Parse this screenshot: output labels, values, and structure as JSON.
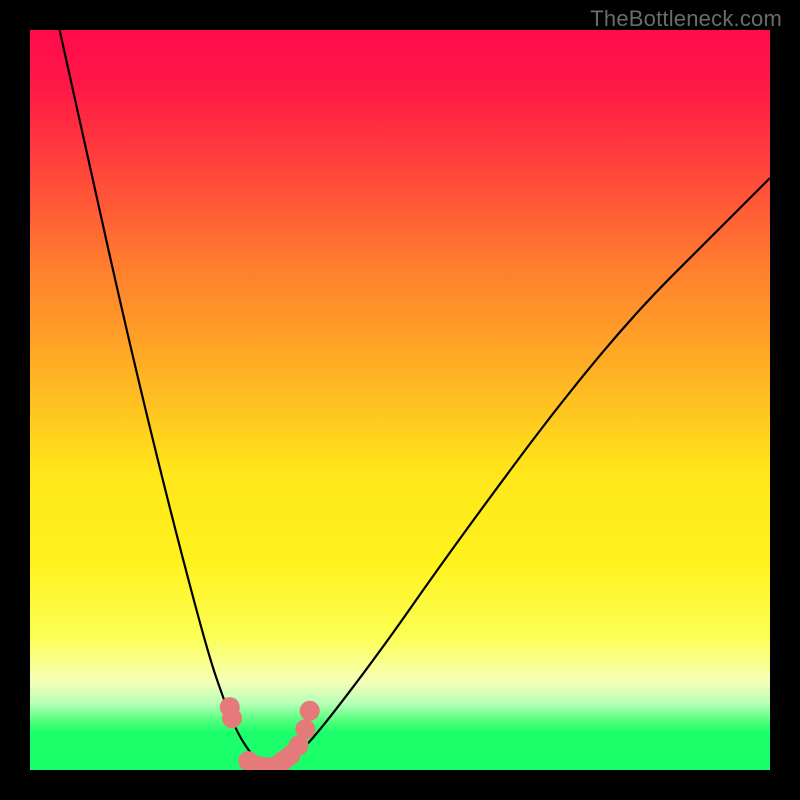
{
  "watermark": "TheBottleneck.com",
  "chart_data": {
    "type": "line",
    "title": "",
    "xlabel": "",
    "ylabel": "",
    "xlim": [
      0,
      100
    ],
    "ylim": [
      0,
      100
    ],
    "grid": false,
    "legend": false,
    "series": [
      {
        "name": "bottleneck-curve",
        "x": [
          4,
          8,
          12,
          16,
          20,
          24,
          26,
          28,
          30,
          31,
          32,
          33,
          34,
          36,
          38,
          42,
          48,
          55,
          63,
          72,
          82,
          92,
          100
        ],
        "values": [
          100,
          82,
          64,
          47,
          31,
          16,
          10,
          5,
          2,
          1,
          0,
          0,
          1,
          2,
          4,
          9,
          17,
          27,
          38,
          50,
          62,
          72,
          80
        ]
      }
    ],
    "markers": [
      {
        "x": 27.0,
        "y": 8.5
      },
      {
        "x": 27.3,
        "y": 7.0
      },
      {
        "x": 29.5,
        "y": 1.2
      },
      {
        "x": 30.0,
        "y": 0.8
      },
      {
        "x": 31.0,
        "y": 0.5
      },
      {
        "x": 32.0,
        "y": 0.4
      },
      {
        "x": 33.5,
        "y": 0.7
      },
      {
        "x": 34.3,
        "y": 1.3
      },
      {
        "x": 35.2,
        "y": 2.0
      },
      {
        "x": 36.3,
        "y": 3.3
      },
      {
        "x": 37.2,
        "y": 5.5
      },
      {
        "x": 37.8,
        "y": 8.0
      }
    ],
    "marker_color": "#e57a7a",
    "marker_radius_px": 10
  }
}
